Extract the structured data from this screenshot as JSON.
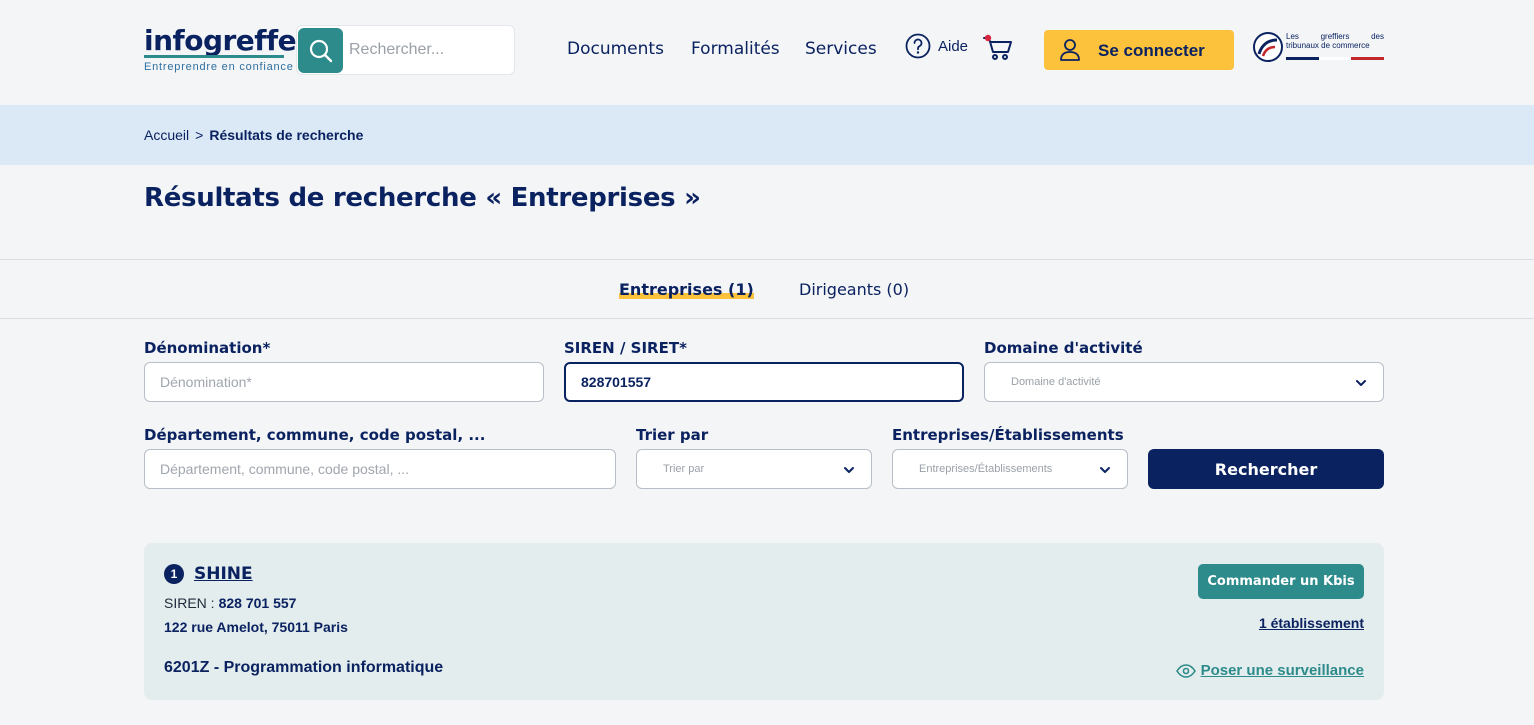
{
  "header": {
    "logo_text": "infogreffe",
    "logo_tagline": "Entreprendre en confiance",
    "search_placeholder": "Rechercher...",
    "nav": [
      "Documents",
      "Formalités",
      "Services"
    ],
    "help_label": "Aide",
    "connect_label": "Se connecter",
    "partner_logo": {
      "line1_words": [
        "Les",
        "greffiers",
        "des"
      ],
      "line2": "tribunaux de commerce"
    }
  },
  "breadcrumb": {
    "home": "Accueil",
    "separator": ">",
    "current": "Résultats de recherche"
  },
  "page_title": "Résultats de recherche « Entreprises »",
  "tabs": [
    {
      "label": "Entreprises (1)",
      "active": true
    },
    {
      "label": "Dirigeants (0)",
      "active": false
    }
  ],
  "form": {
    "denomination": {
      "label": "Dénomination*",
      "placeholder": "Dénomination*",
      "value": ""
    },
    "siren": {
      "label": "SIREN / SIRET*",
      "value": "828701557"
    },
    "domaine": {
      "label": "Domaine d'activité",
      "placeholder": "Domaine d'activité"
    },
    "location": {
      "label": "Département, commune, code postal, ...",
      "placeholder": "Département, commune, code postal, ..."
    },
    "sort": {
      "label": "Trier par",
      "placeholder": "Trier par"
    },
    "type": {
      "label": "Entreprises/Établissements",
      "placeholder": "Entreprises/Établissements"
    },
    "submit_label": "Rechercher"
  },
  "results": [
    {
      "rank": "1",
      "name": "SHINE",
      "siren_label": "SIREN :",
      "siren": "828 701 557",
      "address": "122 rue Amelot, 75011 Paris",
      "activity": "6201Z - Programmation informatique",
      "kbis_label": "Commander un Kbis",
      "etablissements_label": "1 établissement",
      "surveillance_label": "Poser une surveillance"
    }
  ],
  "colors": {
    "navy": "#0b2260",
    "teal": "#2e8b8b",
    "yellow": "#fcc23b",
    "breadcrumb_bg": "#dbe8f6",
    "card_bg": "#e3edee",
    "page_bg": "#f3f5f7"
  }
}
